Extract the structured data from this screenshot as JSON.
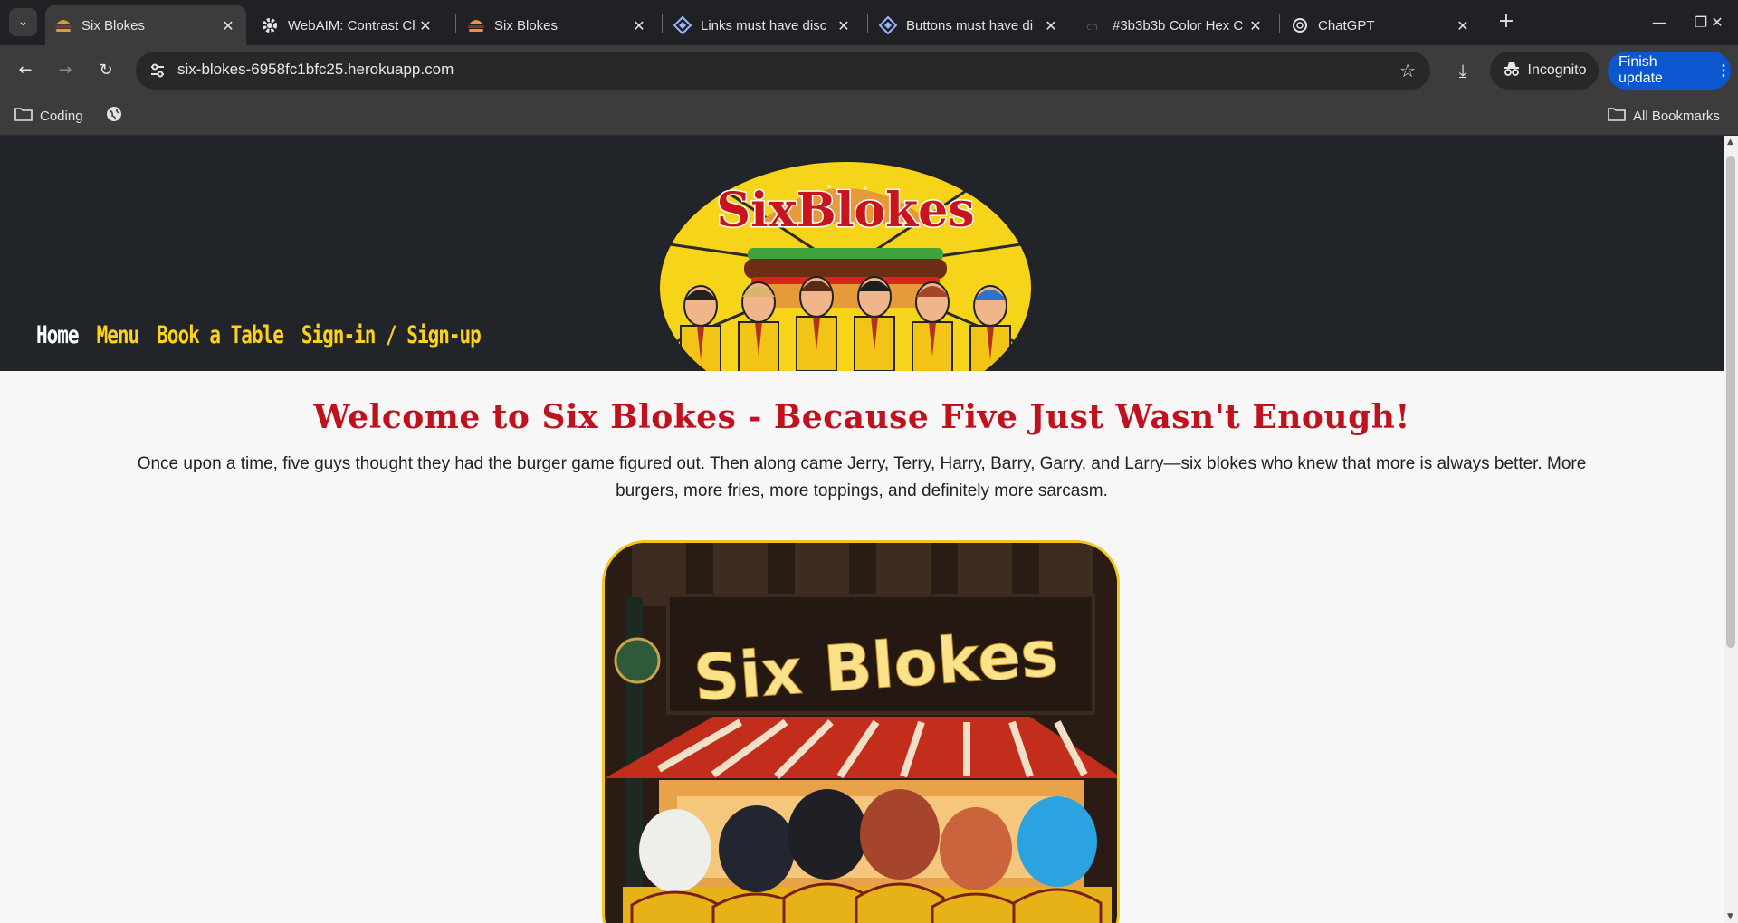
{
  "browser": {
    "tabs": [
      {
        "title": "Six Blokes",
        "icon": "burger-icon",
        "active": true
      },
      {
        "title": "WebAIM: Contrast Ch",
        "icon": "gear-icon",
        "active": false
      },
      {
        "title": "Six Blokes",
        "icon": "burger-icon",
        "active": false
      },
      {
        "title": "Links must have disc",
        "icon": "axe-diamond-icon",
        "active": false
      },
      {
        "title": "Buttons must have di",
        "icon": "axe-diamond-icon",
        "active": false
      },
      {
        "title": "#3b3b3b Color Hex C",
        "icon": "colorhex-icon",
        "active": false
      },
      {
        "title": "ChatGPT",
        "icon": "openai-icon",
        "active": false
      }
    ],
    "url": "six-blokes-6958fc1bfc25.herokuapp.com",
    "incognito_label": "Incognito",
    "finish_update_label": "Finish update",
    "bookmarks": [
      {
        "label": "Coding",
        "icon": "folder-icon"
      },
      {
        "label": "",
        "icon": "globe-icon"
      }
    ],
    "all_bookmarks_label": "All Bookmarks"
  },
  "site": {
    "nav": [
      {
        "label": "Home",
        "current": true
      },
      {
        "label": "Menu",
        "current": false
      },
      {
        "label": "Book a Table",
        "current": false
      },
      {
        "label": "Sign-in / Sign-up",
        "current": false
      }
    ],
    "logo_text": "SixBlokes",
    "welcome_title": "Welcome to Six Blokes - Because Five Just Wasn't Enough!",
    "welcome_text": "Once upon a time, five guys thought they had the burger game figured out. Then along came Jerry, Terry, Harry, Barry, Garry, and Larry—six blokes who knew that more is always better. More burgers, more fries, more toppings, and definitely more sarcasm.",
    "hero_sign_text": "Six Blokes"
  },
  "colors": {
    "header_bg": "#212529",
    "nav_link": "#fcd21c",
    "title_red": "#c0111f",
    "hero_border": "#f5c518"
  }
}
